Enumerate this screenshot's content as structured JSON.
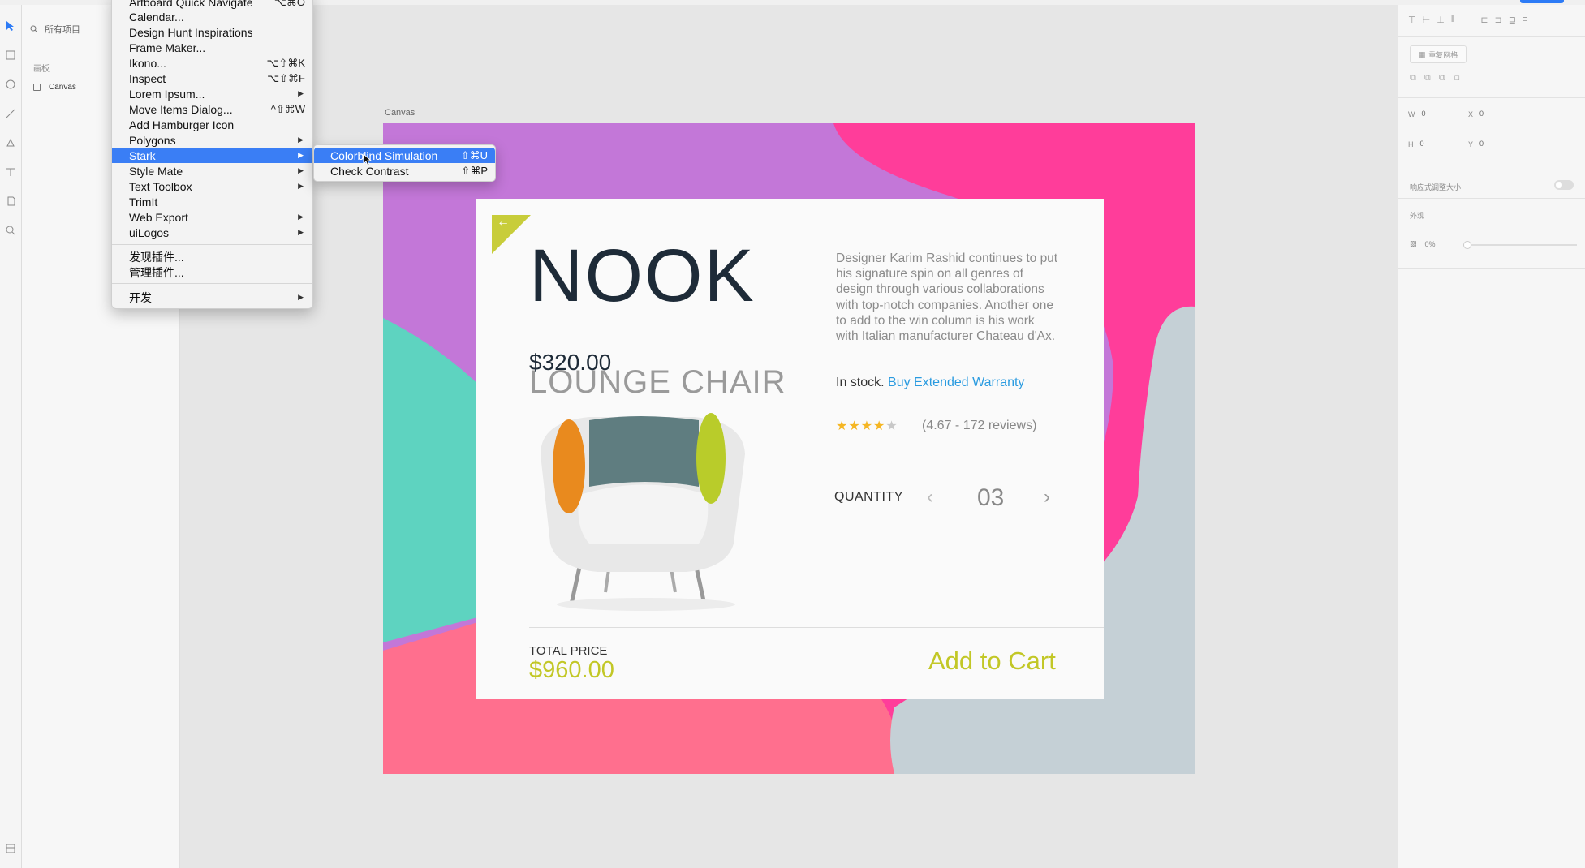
{
  "canvas": {
    "artboard_name": "Canvas"
  },
  "layers": {
    "search_placeholder": "所有项目",
    "section_label": "画板",
    "items": [
      {
        "label": "Canvas"
      }
    ]
  },
  "plugins_menu": {
    "items": [
      {
        "label": "Artboard Quick Navigate",
        "shortcut": "⌥⌘O"
      },
      {
        "label": "Calendar...",
        "shortcut": ""
      },
      {
        "label": "Design Hunt Inspirations",
        "shortcut": ""
      },
      {
        "label": "Frame Maker...",
        "shortcut": ""
      },
      {
        "label": "Ikono...",
        "shortcut": "⌥⇧⌘K"
      },
      {
        "label": "Inspect",
        "shortcut": "⌥⇧⌘F"
      },
      {
        "label": "Lorem Ipsum...",
        "shortcut": ""
      },
      {
        "label": "Move Items Dialog...",
        "shortcut": "^⇧⌘W"
      },
      {
        "label": "Add Hamburger Icon",
        "shortcut": ""
      },
      {
        "label": "Polygons",
        "shortcut": ""
      },
      {
        "label": "Stark",
        "shortcut": ""
      },
      {
        "label": "Style Mate",
        "shortcut": ""
      },
      {
        "label": "Text Toolbox",
        "shortcut": ""
      },
      {
        "label": "TrimIt",
        "shortcut": ""
      },
      {
        "label": "Web Export",
        "shortcut": ""
      },
      {
        "label": "uiLogos",
        "shortcut": ""
      },
      {
        "label": "发现插件...",
        "shortcut": ""
      },
      {
        "label": "管理插件...",
        "shortcut": ""
      },
      {
        "label": "开发",
        "shortcut": ""
      }
    ],
    "submenu_arrow": "▶"
  },
  "stark_submenu": {
    "items": [
      {
        "label": "Colorblind Simulation",
        "shortcut": "⇧⌘U"
      },
      {
        "label": "Check Contrast",
        "shortcut": "⇧⌘P"
      }
    ]
  },
  "product_card": {
    "back_arrow": "←",
    "brand": "NOOK",
    "price": "$320.00",
    "product_name": "LOUNGE CHAIR",
    "description": "Designer Karim Rashid continues to put his signature spin on all genres of design through various collaborations with top-notch companies. Another one to add to the win column is his work with Italian manufacturer Chateau d'Ax.",
    "stock_text": "In stock.",
    "warranty_link": "Buy Extended Warranty",
    "stars_filled": "★★★★",
    "stars_empty": "★",
    "rating": 4.67,
    "reviews_text": "(4.67 - 172 reviews)",
    "quantity_label": "QUANTITY",
    "quantity_prev": "‹",
    "quantity_value": "03",
    "quantity_next": "›",
    "total_label": "TOTAL PRICE",
    "total_value": "$960.00",
    "add_to_cart": "Add to Cart",
    "accent_color": "#c2c726"
  },
  "inspector": {
    "repeat_grid": "重复网格",
    "w_label": "W",
    "w_value": "0",
    "x_label": "X",
    "x_value": "0",
    "h_label": "H",
    "h_value": "0",
    "y_label": "Y",
    "y_value": "0",
    "responsive_label": "响应式调整大小",
    "appearance_label": "外观",
    "opacity_value": "0%"
  },
  "colors": {
    "purple": "#c377d8",
    "pink": "#ff3d9a",
    "teal": "#5ed3c0",
    "coral": "#ff6f8e",
    "gray_blue": "#c5d0d6",
    "menu_highlight": "#3a7ef5"
  }
}
